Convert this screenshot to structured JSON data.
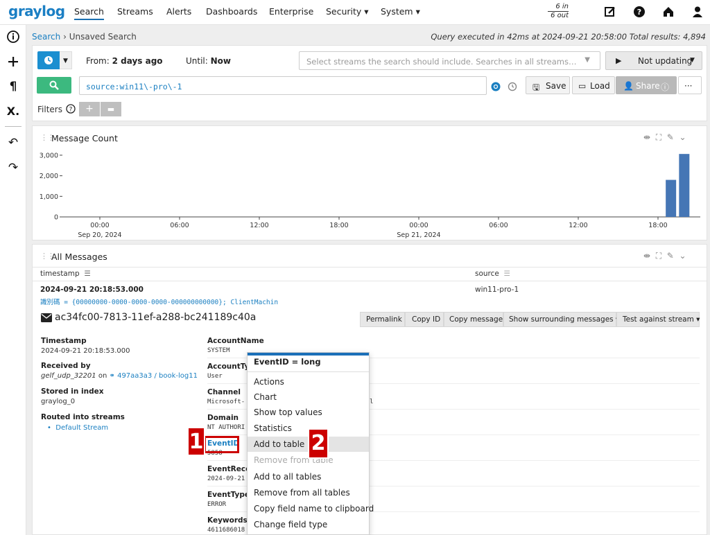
{
  "nav": {
    "logo": "graylog",
    "items": [
      "Search",
      "Streams",
      "Alerts",
      "Dashboards",
      "Enterprise",
      "Security ▾",
      "System ▾"
    ],
    "throughput_in": "6 in",
    "throughput_out": "6 out"
  },
  "breadcrumb": {
    "root": "Search",
    "sep": "›",
    "current": "Unsaved Search"
  },
  "query_info": "Query executed in 42ms at 2024-09-21 20:58:00 Total results: 4,894",
  "search_bar": {
    "from_label": "From:",
    "from_value": "2 days ago",
    "until_label": "Until:",
    "until_value": "Now",
    "streams_placeholder": "Select streams the search should include. Searches in all streams…",
    "refresh_label": "Not updating",
    "query": "source:win11\\-pro\\-1",
    "save_label": "Save",
    "load_label": "Load",
    "share_label": "Share",
    "more_label": "···",
    "filters_label": "Filters"
  },
  "message_count_widget": {
    "title": "Message Count",
    "chart_data": {
      "type": "bar",
      "x_ticks": [
        "00:00",
        "06:00",
        "12:00",
        "18:00",
        "00:00",
        "06:00",
        "12:00",
        "18:00"
      ],
      "x_dates": [
        "Sep 20, 2024",
        "Sep 21, 2024"
      ],
      "y_ticks": [
        "0",
        "1,000",
        "2,000",
        "3,000"
      ],
      "ylim": [
        0,
        3200
      ],
      "bars": [
        {
          "x": "2024-09-21 19:00",
          "value": 1800
        },
        {
          "x": "2024-09-21 20:00",
          "value": 3060
        }
      ],
      "color": "#4576b5"
    }
  },
  "all_messages_widget": {
    "title": "All Messages",
    "col_timestamp": "timestamp",
    "col_source": "source",
    "row_timestamp": "2024-09-21 20:18:53.000",
    "row_source": "win11-pro-1",
    "row_message": "識別碼 = {00000000-0000-0000-0000-000000000000}; ClientMachin",
    "message_id": "ac34fc00-7813-11ef-a288-bc241189c40a",
    "actions": [
      "Permalink",
      "Copy ID",
      "Copy message",
      "Show surrounding messages ▾",
      "Test against stream ▾"
    ],
    "meta": {
      "timestamp_label": "Timestamp",
      "timestamp_value": "2024-09-21 20:18:53.000",
      "received_label": "Received by",
      "received_input": "gelf_udp_32201",
      "received_on": "on",
      "received_node": "497aa3a3 / book-log11",
      "index_label": "Stored in index",
      "index_value": "graylog_0",
      "routed_label": "Routed into streams",
      "routed_value": "Default Stream"
    },
    "fields": [
      {
        "name": "AccountName",
        "value": "SYSTEM"
      },
      {
        "name": "AccountTyp",
        "value": "User"
      },
      {
        "name": "Channel",
        "value": "Microsoft-"
      },
      {
        "name": "Domain",
        "value": "NT AUTHORI"
      },
      {
        "name": "EventID",
        "value": "5858"
      },
      {
        "name": "EventRecei",
        "value": "2024-09-21"
      },
      {
        "name": "EventType",
        "value": "ERROR"
      },
      {
        "name": "Keywords",
        "value": "4611686018"
      }
    ],
    "channel_tail": "l"
  },
  "context_menu": {
    "header": "EventID = long",
    "items": [
      "Actions",
      "Chart",
      "Show top values",
      "Statistics",
      "Add to table",
      "Remove from table",
      "Add to all tables",
      "Remove from all tables",
      "Copy field name to clipboard",
      "Change field type"
    ]
  },
  "annotations": {
    "one": "1",
    "two": "2"
  },
  "colors": {
    "accent": "#1a7fc1",
    "search_green": "#3cb97f",
    "time_blue": "#1b8fd0",
    "annotation_red": "#cc0000"
  }
}
